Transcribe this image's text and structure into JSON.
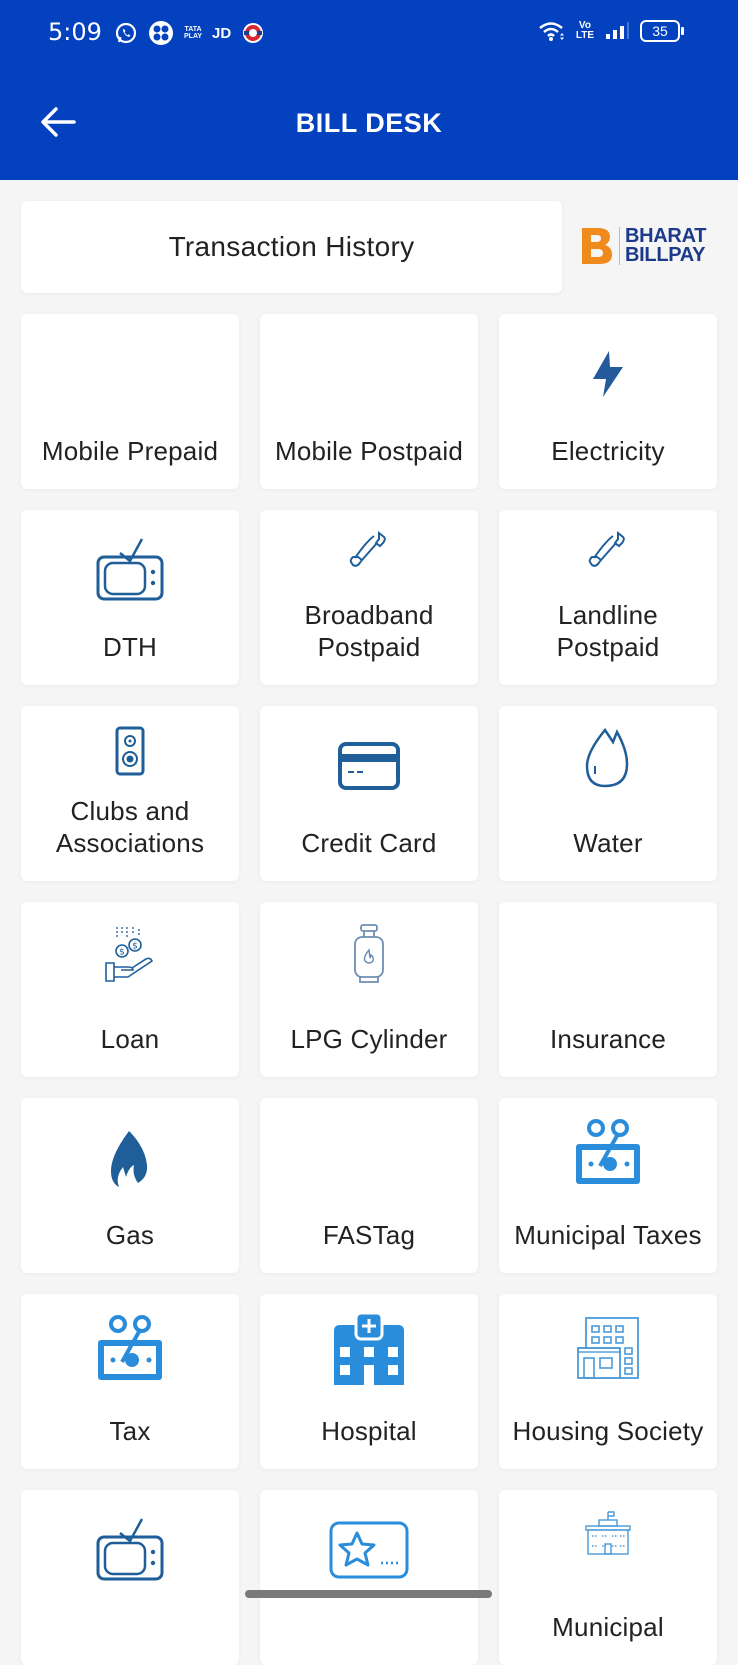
{
  "status_bar": {
    "time": "5:09",
    "left_icons": [
      "whatsapp-icon",
      "app-icon",
      "tata-play-icon",
      "jd-icon",
      "metro-icon"
    ],
    "tata_play_label": "TATA PLAY",
    "jd_label": "JD",
    "volte_label": "Vo LTE",
    "battery_level": "35"
  },
  "header": {
    "title": "BILL DESK",
    "background": "#0341be"
  },
  "transaction_history": {
    "label": "Transaction History"
  },
  "brand": {
    "line1": "BHARAT",
    "line2": "BILLPAY",
    "accent": "#f08a1d",
    "text_color": "#1d3a8a"
  },
  "categories": [
    {
      "label": "Mobile Prepaid",
      "icon": "none"
    },
    {
      "label": "Mobile Postpaid",
      "icon": "none"
    },
    {
      "label": "Electricity",
      "icon": "lightning-icon"
    },
    {
      "label": "DTH",
      "icon": "tv-icon"
    },
    {
      "label": "Broadband\nPostpaid",
      "icon": "phone-icon"
    },
    {
      "label": "Landline\nPostpaid",
      "icon": "phone-icon"
    },
    {
      "label": "Clubs and\nAssociations",
      "icon": "speaker-icon"
    },
    {
      "label": "Credit Card",
      "icon": "credit-card-icon"
    },
    {
      "label": "Water",
      "icon": "water-drop-icon"
    },
    {
      "label": "Loan",
      "icon": "loan-hand-icon"
    },
    {
      "label": "LPG Cylinder",
      "icon": "gas-cylinder-icon"
    },
    {
      "label": "Insurance",
      "icon": "none"
    },
    {
      "label": "Gas",
      "icon": "flame-icon"
    },
    {
      "label": "FASTag",
      "icon": "none"
    },
    {
      "label": "Municipal Taxes",
      "icon": "tax-money-icon"
    },
    {
      "label": "Tax",
      "icon": "tax-money-icon"
    },
    {
      "label": "Hospital",
      "icon": "hospital-icon"
    },
    {
      "label": "Housing Society",
      "icon": "building-icon"
    },
    {
      "label": "",
      "icon": "tv-icon"
    },
    {
      "label": "",
      "icon": "star-card-icon"
    },
    {
      "label": "Municipal",
      "icon": "government-building-icon"
    }
  ],
  "colors": {
    "icon_dark": "#1f5e99",
    "icon_light": "#2a8ddb"
  }
}
